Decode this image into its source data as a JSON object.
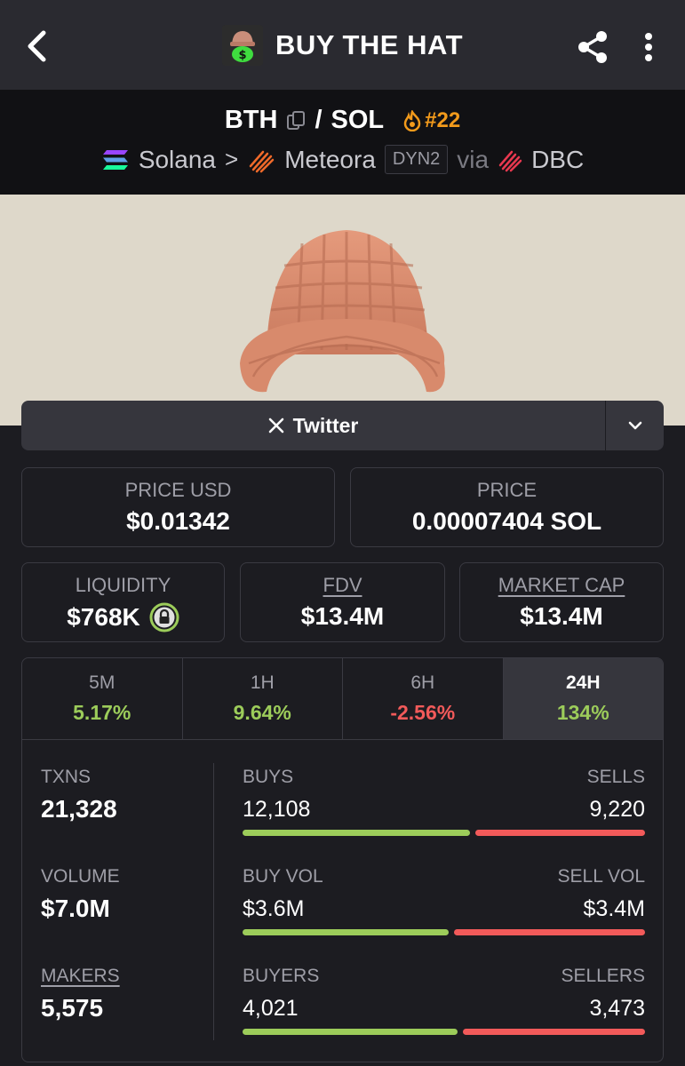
{
  "header": {
    "title": "BUY THE HAT"
  },
  "pair": {
    "base": "BTH",
    "separator": "/",
    "quote": "SOL",
    "rank": "#22",
    "chain": "Solana",
    "arrow": ">",
    "dex": "Meteora",
    "dex_version": "DYN2",
    "via": "via",
    "launchpad": "DBC"
  },
  "social": {
    "twitter_label": "Twitter"
  },
  "prices": {
    "price_usd_label": "PRICE USD",
    "price_usd": "$0.01342",
    "price_label": "PRICE",
    "price_native": "0.00007404 SOL"
  },
  "metrics": {
    "liquidity_label": "LIQUIDITY",
    "liquidity": "$768K",
    "fdv_label": "FDV",
    "fdv": "$13.4M",
    "mcap_label": "MARKET CAP",
    "mcap": "$13.4M"
  },
  "tabs": [
    {
      "label": "5M",
      "change": "5.17%"
    },
    {
      "label": "1H",
      "change": "9.64%"
    },
    {
      "label": "6H",
      "change": "-2.56%"
    },
    {
      "label": "24H",
      "change": "134%"
    }
  ],
  "stats": {
    "txns_label": "TXNS",
    "txns": "21,328",
    "volume_label": "VOLUME",
    "volume": "$7.0M",
    "makers_label": "MAKERS",
    "makers": "5,575",
    "buys_label": "BUYS",
    "buys": "12,108",
    "sells_label": "SELLS",
    "sells": "9,220",
    "buy_vol_label": "BUY VOL",
    "buy_vol": "$3.6M",
    "sell_vol_label": "SELL VOL",
    "sell_vol": "$3.4M",
    "buyers_label": "BUYERS",
    "buyers": "4,021",
    "sellers_label": "SELLERS",
    "sellers": "3,473"
  },
  "colors": {
    "positive": "#9ccc5a",
    "negative": "#f25a5a",
    "rank": "#f29a1b",
    "lock": "#9ccc5a"
  },
  "icons": [
    "back-arrow-icon",
    "share-icon",
    "more-vertical-icon",
    "copy-icon",
    "flame-icon",
    "solana-icon",
    "chevron-right-icon",
    "meteora-icon",
    "dbc-icon",
    "x-logo-icon",
    "chevron-down-icon",
    "lock-icon"
  ]
}
